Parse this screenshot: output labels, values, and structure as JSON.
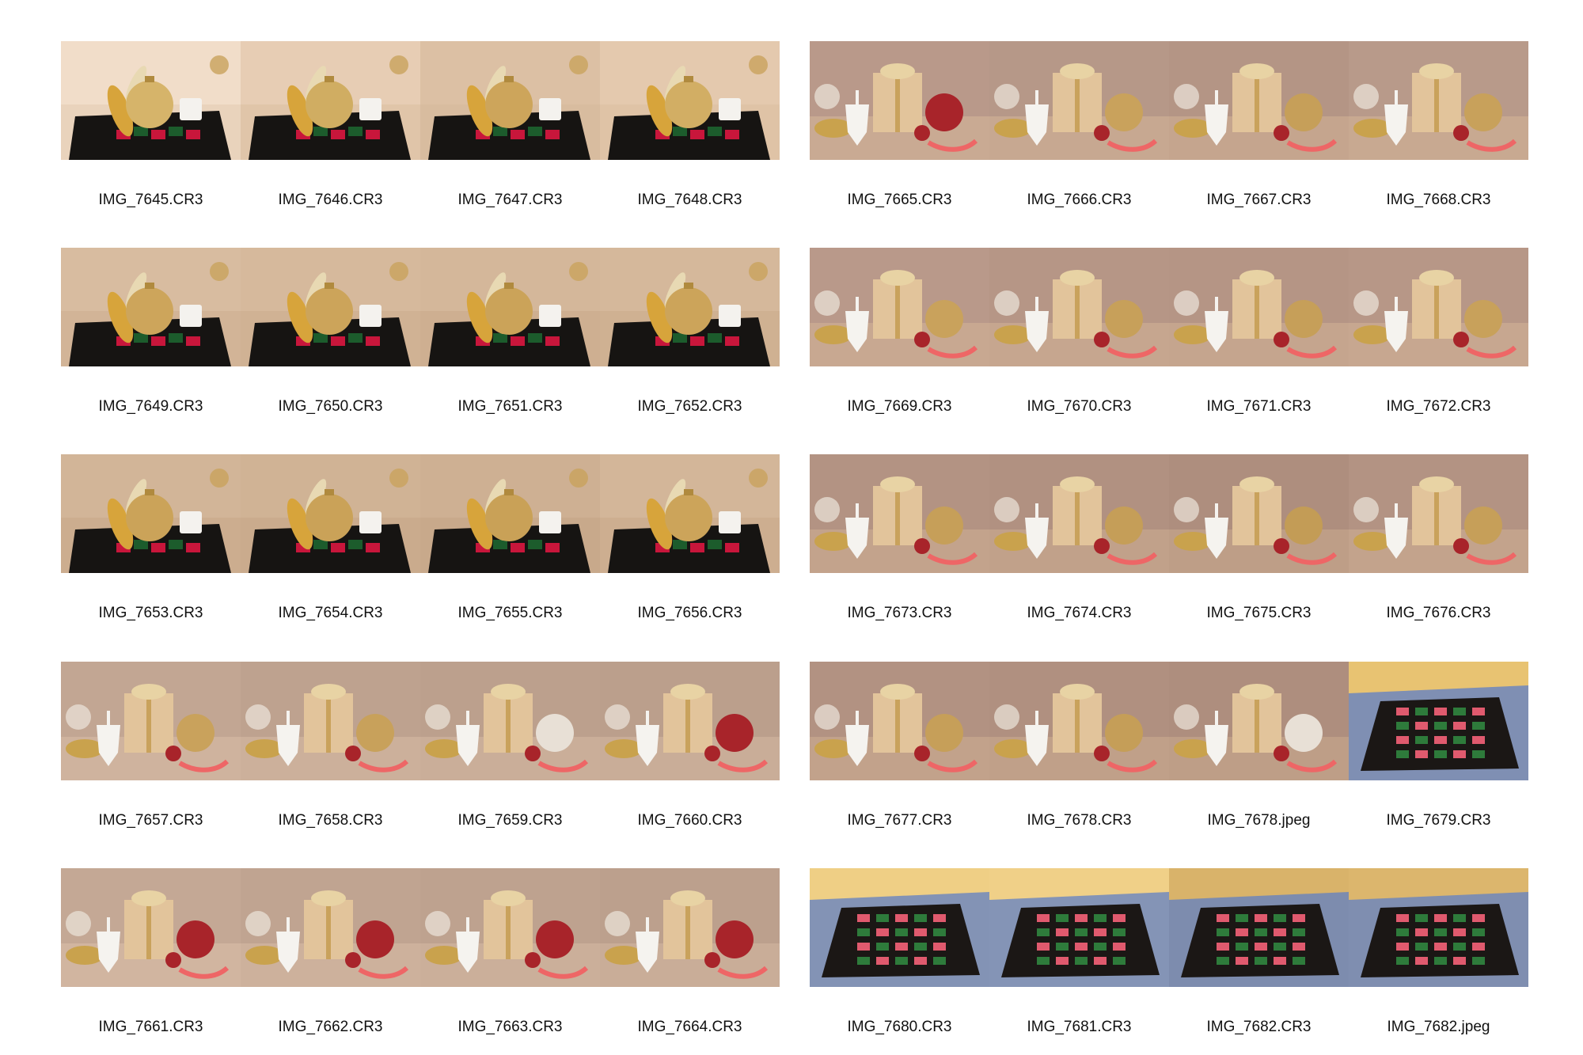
{
  "contact_sheet": {
    "cells": [
      {
        "filename": "IMG_7645.CR3",
        "scene": "ornament-on-mat",
        "bg": "#f1ddc9",
        "table": "#e9d3bc",
        "ball": "#d6b46a"
      },
      {
        "filename": "IMG_7646.CR3",
        "scene": "ornament-on-mat",
        "bg": "#e7cdb4",
        "table": "#e0c5a9",
        "ball": "#d0ad62"
      },
      {
        "filename": "IMG_7647.CR3",
        "scene": "ornament-on-mat",
        "bg": "#dcc0a4",
        "table": "#d8bc9f",
        "ball": "#cda55b"
      },
      {
        "filename": "IMG_7648.CR3",
        "scene": "ornament-on-mat",
        "bg": "#e4c9ae",
        "table": "#dfc3a6",
        "ball": "#d2ae64"
      },
      {
        "filename": "IMG_7665.CR3",
        "scene": "gift-dreidel",
        "bg": "#b9998a",
        "table": "#c9aa93",
        "ball": "#a8242a"
      },
      {
        "filename": "IMG_7666.CR3",
        "scene": "gift-dreidel",
        "bg": "#b69888",
        "table": "#c7a891",
        "ball": "#c9a25c"
      },
      {
        "filename": "IMG_7667.CR3",
        "scene": "gift-dreidel",
        "bg": "#b49585",
        "table": "#c5a58e",
        "ball": "#c69f59"
      },
      {
        "filename": "IMG_7668.CR3",
        "scene": "gift-dreidel",
        "bg": "#b89a8a",
        "table": "#c8a991",
        "ball": "#c8a15b"
      },
      {
        "filename": "IMG_7649.CR3",
        "scene": "ornament-on-mat",
        "bg": "#d8bca0",
        "table": "#d2b497",
        "ball": "#cda55b"
      },
      {
        "filename": "IMG_7650.CR3",
        "scene": "ornament-on-mat",
        "bg": "#d6b99c",
        "table": "#d0b294",
        "ball": "#cca45a"
      },
      {
        "filename": "IMG_7651.CR3",
        "scene": "ornament-on-mat",
        "bg": "#d4b79a",
        "table": "#ceaf91",
        "ball": "#cba359"
      },
      {
        "filename": "IMG_7652.CR3",
        "scene": "ornament-on-mat",
        "bg": "#d5b89b",
        "table": "#cfb192",
        "ball": "#cca45a"
      },
      {
        "filename": "IMG_7669.CR3",
        "scene": "gift-dreidel",
        "bg": "#b9998a",
        "table": "#c8a891",
        "ball": "#c9a25c"
      },
      {
        "filename": "IMG_7670.CR3",
        "scene": "gift-dreidel",
        "bg": "#b69686",
        "table": "#c6a68f",
        "ball": "#c7a05a"
      },
      {
        "filename": "IMG_7671.CR3",
        "scene": "gift-dreidel",
        "bg": "#b59585",
        "table": "#c5a58e",
        "ball": "#c69f59"
      },
      {
        "filename": "IMG_7672.CR3",
        "scene": "gift-dreidel",
        "bg": "#b79787",
        "table": "#c7a790",
        "ball": "#c8a15b"
      },
      {
        "filename": "IMG_7653.CR3",
        "scene": "ornament-on-mat",
        "bg": "#d2b598",
        "table": "#ccad8f",
        "ball": "#cba359"
      },
      {
        "filename": "IMG_7654.CR3",
        "scene": "ornament-on-mat",
        "bg": "#d0b395",
        "table": "#caab8d",
        "ball": "#caa258"
      },
      {
        "filename": "IMG_7655.CR3",
        "scene": "ornament-on-mat",
        "bg": "#ceb093",
        "table": "#c8a98b",
        "ball": "#c9a157"
      },
      {
        "filename": "IMG_7656.CR3",
        "scene": "ornament-on-mat",
        "bg": "#d3b699",
        "table": "#cdae90",
        "ball": "#cca45a"
      },
      {
        "filename": "IMG_7673.CR3",
        "scene": "gift-dreidel",
        "bg": "#b39383",
        "table": "#c3a38c",
        "ball": "#c69f59"
      },
      {
        "filename": "IMG_7674.CR3",
        "scene": "gift-dreidel",
        "bg": "#b19181",
        "table": "#c1a18a",
        "ball": "#c59e58"
      },
      {
        "filename": "IMG_7675.CR3",
        "scene": "gift-dreidel",
        "bg": "#ae8e7e",
        "table": "#be9e87",
        "ball": "#c39c56"
      },
      {
        "filename": "IMG_7676.CR3",
        "scene": "gift-dreidel",
        "bg": "#b39383",
        "table": "#c3a38c",
        "ball": "#c69f59"
      },
      {
        "filename": "IMG_7657.CR3",
        "scene": "gift-dreidel",
        "bg": "#c2a693",
        "table": "#cfb39e",
        "ball": "#c9a25c"
      },
      {
        "filename": "IMG_7658.CR3",
        "scene": "gift-dreidel",
        "bg": "#bea28f",
        "table": "#ccb09b",
        "ball": "#c8a15b"
      },
      {
        "filename": "IMG_7659.CR3",
        "scene": "gift-dreidel",
        "bg": "#bca08d",
        "table": "#caae99",
        "ball": "#e8e0d6"
      },
      {
        "filename": "IMG_7660.CR3",
        "scene": "gift-dreidel",
        "bg": "#bb9f8c",
        "table": "#c9ad98",
        "ball": "#a8242a"
      },
      {
        "filename": "IMG_7677.CR3",
        "scene": "gift-dreidel",
        "bg": "#b29282",
        "table": "#c2a28b",
        "ball": "#c69f59"
      },
      {
        "filename": "IMG_7678.CR3",
        "scene": "gift-dreidel",
        "bg": "#b09080",
        "table": "#c0a089",
        "ball": "#c59e58"
      },
      {
        "filename": "IMG_7678.jpeg",
        "scene": "gift-dreidel",
        "bg": "#ae8e7e",
        "table": "#be9e87",
        "ball": "#e8e0d6"
      },
      {
        "filename": "IMG_7679.CR3",
        "scene": "checker-mat",
        "bg": "#e8c372",
        "table": "#7f8fb3",
        "ball": "#000000"
      },
      {
        "filename": "IMG_7661.CR3",
        "scene": "gift-dreidel",
        "bg": "#c4a895",
        "table": "#d1b5a0",
        "ball": "#a8242a"
      },
      {
        "filename": "IMG_7662.CR3",
        "scene": "gift-dreidel",
        "bg": "#c0a491",
        "table": "#cdb19c",
        "ball": "#a8242a"
      },
      {
        "filename": "IMG_7663.CR3",
        "scene": "gift-dreidel",
        "bg": "#bea28f",
        "table": "#cbaf9a",
        "ball": "#a8242a"
      },
      {
        "filename": "IMG_7664.CR3",
        "scene": "gift-dreidel",
        "bg": "#bca08d",
        "table": "#c9ad98",
        "ball": "#a8242a"
      },
      {
        "filename": "IMG_7680.CR3",
        "scene": "checker-mat",
        "bg": "#efcf85",
        "table": "#8393b5",
        "ball": "#000000"
      },
      {
        "filename": "IMG_7681.CR3",
        "scene": "checker-mat",
        "bg": "#f0d088",
        "table": "#8494b6",
        "ball": "#000000"
      },
      {
        "filename": "IMG_7682.CR3",
        "scene": "checker-mat",
        "bg": "#d9b36a",
        "table": "#7d8cae",
        "ball": "#000000"
      },
      {
        "filename": "IMG_7682.jpeg",
        "scene": "checker-mat",
        "bg": "#dcb66d",
        "table": "#7f8eb0",
        "ball": "#000000"
      }
    ]
  }
}
